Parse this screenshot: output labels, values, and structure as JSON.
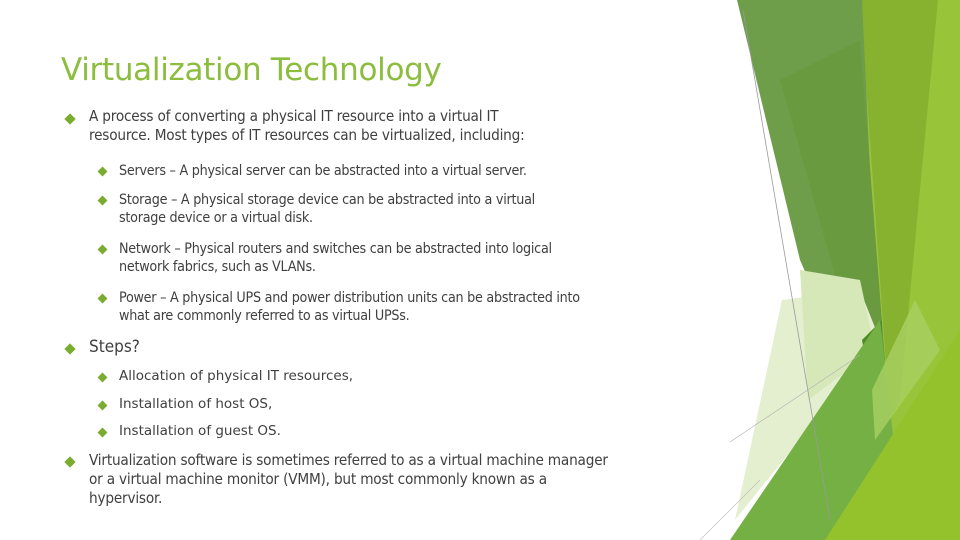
{
  "slide": {
    "title": "Virtualization Technology",
    "accent_color": "#8cbd3f",
    "bullet_color": "#7aac2f",
    "bullets": [
      {
        "lines": [
          "A process of converting a physical IT resource into a virtual IT",
          "resource. Most types of IT resources can be virtualized, including:"
        ],
        "sub": [
          {
            "lines": [
              "Servers – A physical server can be abstracted into a virtual server."
            ]
          },
          {
            "lines": [
              "Storage – A physical storage device can be abstracted into a virtual",
              "storage device or a virtual disk."
            ]
          },
          {
            "lines": [
              "Network – Physical routers and switches can be abstracted into logical",
              "network fabrics, such as VLANs."
            ]
          },
          {
            "lines": [
              "Power – A physical UPS and power distribution units can be abstracted into",
              "what are commonly referred to as virtual UPSs."
            ]
          }
        ]
      },
      {
        "lines": [
          "Steps?"
        ],
        "sub": [
          {
            "lines": [
              "Allocation of physical IT resources,"
            ]
          },
          {
            "lines": [
              "Installation of host OS,"
            ]
          },
          {
            "lines": [
              "Installation of guest OS."
            ]
          }
        ]
      },
      {
        "lines": [
          "Virtualization software is sometimes referred to as a virtual machine manager",
          "or a virtual machine monitor (VMM), but most commonly known as a",
          "hypervisor."
        ],
        "sub": []
      }
    ]
  }
}
